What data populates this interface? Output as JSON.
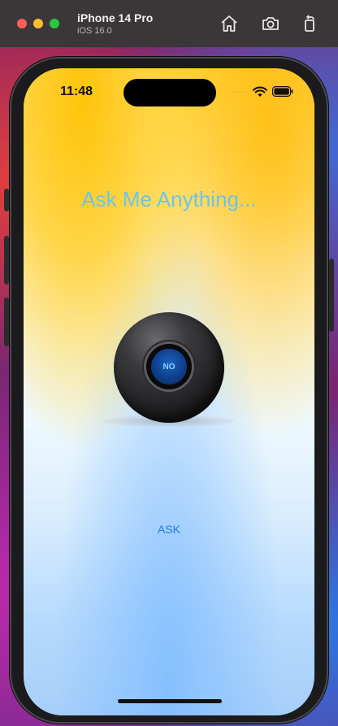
{
  "simulator": {
    "device_name": "iPhone 14 Pro",
    "os_version": "iOS 16.0",
    "toolbar": {
      "home_icon": "home-icon",
      "screenshot_icon": "camera-icon",
      "rotate_icon": "rotate-icon"
    }
  },
  "status_bar": {
    "time": "11:48",
    "signal_dots": "····"
  },
  "app": {
    "title": "Ask Me Anything...",
    "answer": "NO",
    "ask_button": "ASK"
  },
  "colors": {
    "title": "#6fc3ea",
    "ask_button": "#1f7ae0",
    "ball_window": "#1a62c0"
  }
}
